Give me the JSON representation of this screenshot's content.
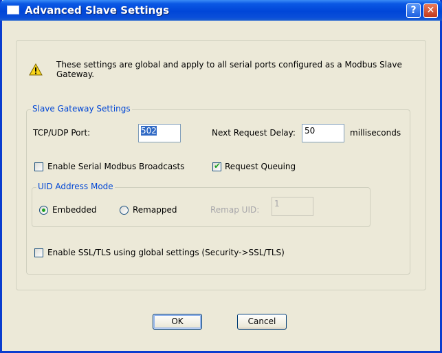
{
  "window": {
    "title": "Advanced Slave Settings",
    "help_glyph": "?",
    "close_glyph": "✕"
  },
  "notice": {
    "icon": "warning-icon",
    "text": "These settings are global and apply to all serial ports configured as a Modbus Slave Gateway."
  },
  "slave_gateway": {
    "legend": "Slave Gateway Settings",
    "tcp_udp_port_label": "TCP/UDP Port:",
    "tcp_udp_port_value": "502",
    "next_request_delay_label": "Next Request Delay:",
    "next_request_delay_value": "50",
    "next_request_delay_unit": "milliseconds",
    "enable_broadcasts_label": "Enable Serial Modbus Broadcasts",
    "enable_broadcasts_checked": false,
    "request_queuing_label": "Request Queuing",
    "request_queuing_checked": true,
    "uid_mode": {
      "legend": "UID Address Mode",
      "embedded_label": "Embedded",
      "remapped_label": "Remapped",
      "selected": "Embedded",
      "remap_uid_label": "Remap UID:",
      "remap_uid_value": "1"
    },
    "ssl_label": "Enable SSL/TLS using global settings (Security->SSL/TLS)",
    "ssl_checked": false
  },
  "buttons": {
    "ok": "OK",
    "cancel": "Cancel"
  },
  "colors": {
    "title_bar": "#0046d8",
    "dialog_bg": "#ece9d8",
    "legend_text": "#0046d5",
    "check_mark": "#21a121"
  }
}
